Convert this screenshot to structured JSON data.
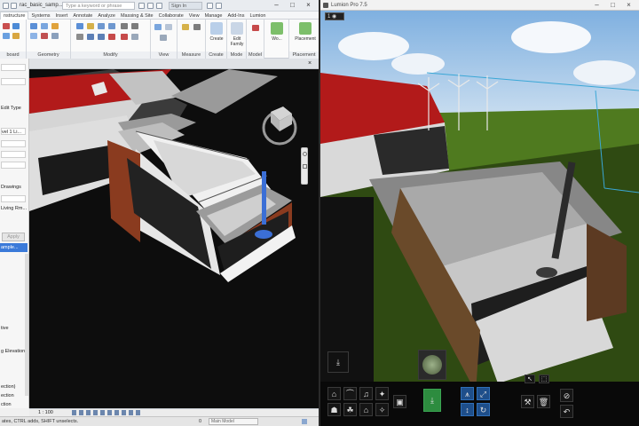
{
  "revit": {
    "file_name": "rac_basic_samp...",
    "search_placeholder": "Type a keyword or phrase",
    "user": "Sign In",
    "tabs": [
      "nstructure",
      "Systems",
      "Insert",
      "Annotate",
      "Analyze",
      "Massing & Site",
      "Collaborate",
      "View",
      "Manage",
      "Add-Ins",
      "Lumion"
    ],
    "active_tab": 0,
    "panels": {
      "clipboard": "board",
      "geometry": "Geometry",
      "modify": "Modify",
      "view": "View",
      "measure": "Measure",
      "create": "Create",
      "mode": "Mode",
      "model": "Model",
      "placement": "Placement"
    },
    "buttons": {
      "create": "Create",
      "edit_family": "Edit Family",
      "wo": "Wo...",
      "placement": "Placement"
    },
    "properties": {
      "edit_type": "Edit Type",
      "level": "vel 1 Li...",
      "drawings": "Drawings",
      "living": "Living Rm...",
      "apply": "Apply",
      "browser": "ample...",
      "tree": [
        "tive",
        "",
        "g Elevation",
        "",
        "ection)",
        "ection",
        "ction"
      ]
    },
    "viewbar": {
      "scale": "1 : 100",
      "model": "Main Model"
    },
    "statusbar": "ates, CTRL adds, SHIFT unselects.",
    "scroll_value": "0"
  },
  "lumion": {
    "title": "Lumion Pro 7.5",
    "badge": "1 ◉",
    "icons": [
      "download-icon",
      "foot-icon",
      "boat-icon",
      "music-icon",
      "sparkle-icon",
      "walk-icon",
      "run-icon",
      "house-icon",
      "magic-icon",
      "save-icon",
      "place-icon",
      "mountain-icon",
      "expand-icon",
      "move-icon",
      "rotate-icon",
      "wrench-icon",
      "trash-icon",
      "cursor-icon",
      "select-icon",
      "clock-icon",
      "undo-icon"
    ]
  },
  "colors": {
    "revit_bg": "#f0f0f0",
    "roof_red": "#b21a1a",
    "timber": "#8a3b1f",
    "sky": "#a5c7e8",
    "grass": "#4f7a1f",
    "accent": "#2f6fd6"
  }
}
